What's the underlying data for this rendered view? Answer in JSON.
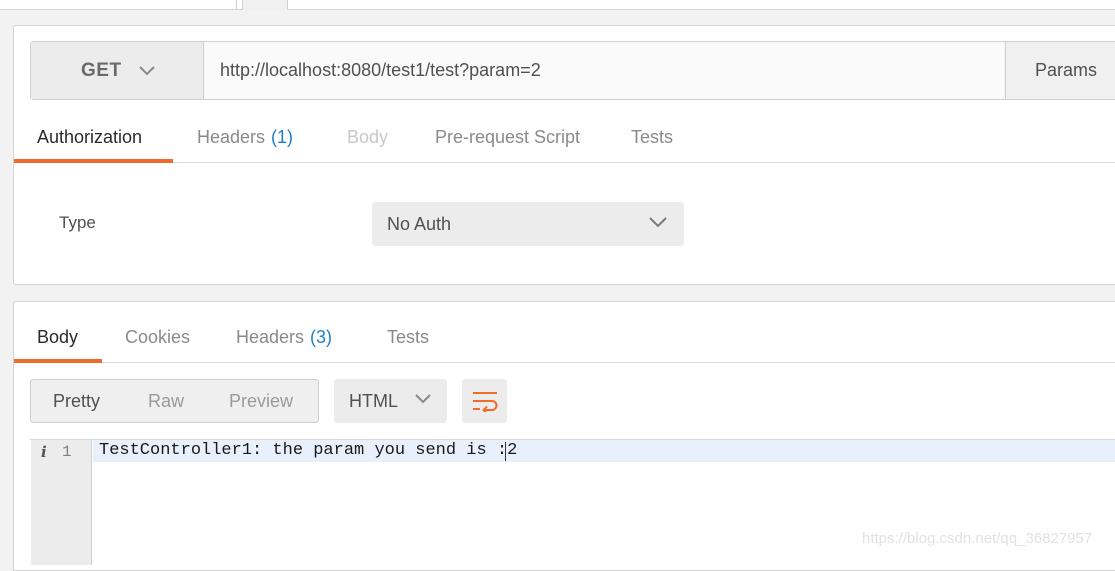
{
  "request": {
    "method": "GET",
    "url": "http://localhost:8080/test1/test?param=2",
    "params_label": "Params",
    "tabs": [
      {
        "label": "Authorization",
        "count": ""
      },
      {
        "label": "Headers",
        "count": "(1)"
      },
      {
        "label": "Body",
        "count": ""
      },
      {
        "label": "Pre-request Script",
        "count": ""
      },
      {
        "label": "Tests",
        "count": ""
      }
    ],
    "active_tab": "Authorization",
    "auth": {
      "type_label": "Type",
      "type_value": "No Auth"
    }
  },
  "response": {
    "tabs": [
      {
        "label": "Body",
        "count": ""
      },
      {
        "label": "Cookies",
        "count": ""
      },
      {
        "label": "Headers",
        "count": "(3)"
      },
      {
        "label": "Tests",
        "count": ""
      }
    ],
    "active_tab": "Body",
    "view_modes": [
      "Pretty",
      "Raw",
      "Preview"
    ],
    "active_view_mode": "Pretty",
    "format": "HTML",
    "editor": {
      "line_number": "1",
      "info_glyph": "i",
      "content": "TestController1: the param you send is :2"
    }
  },
  "watermark": "https://blog.csdn.net/qq_36827957",
  "colors": {
    "accent": "#f06a2a",
    "count_blue": "#1e7fc8"
  }
}
